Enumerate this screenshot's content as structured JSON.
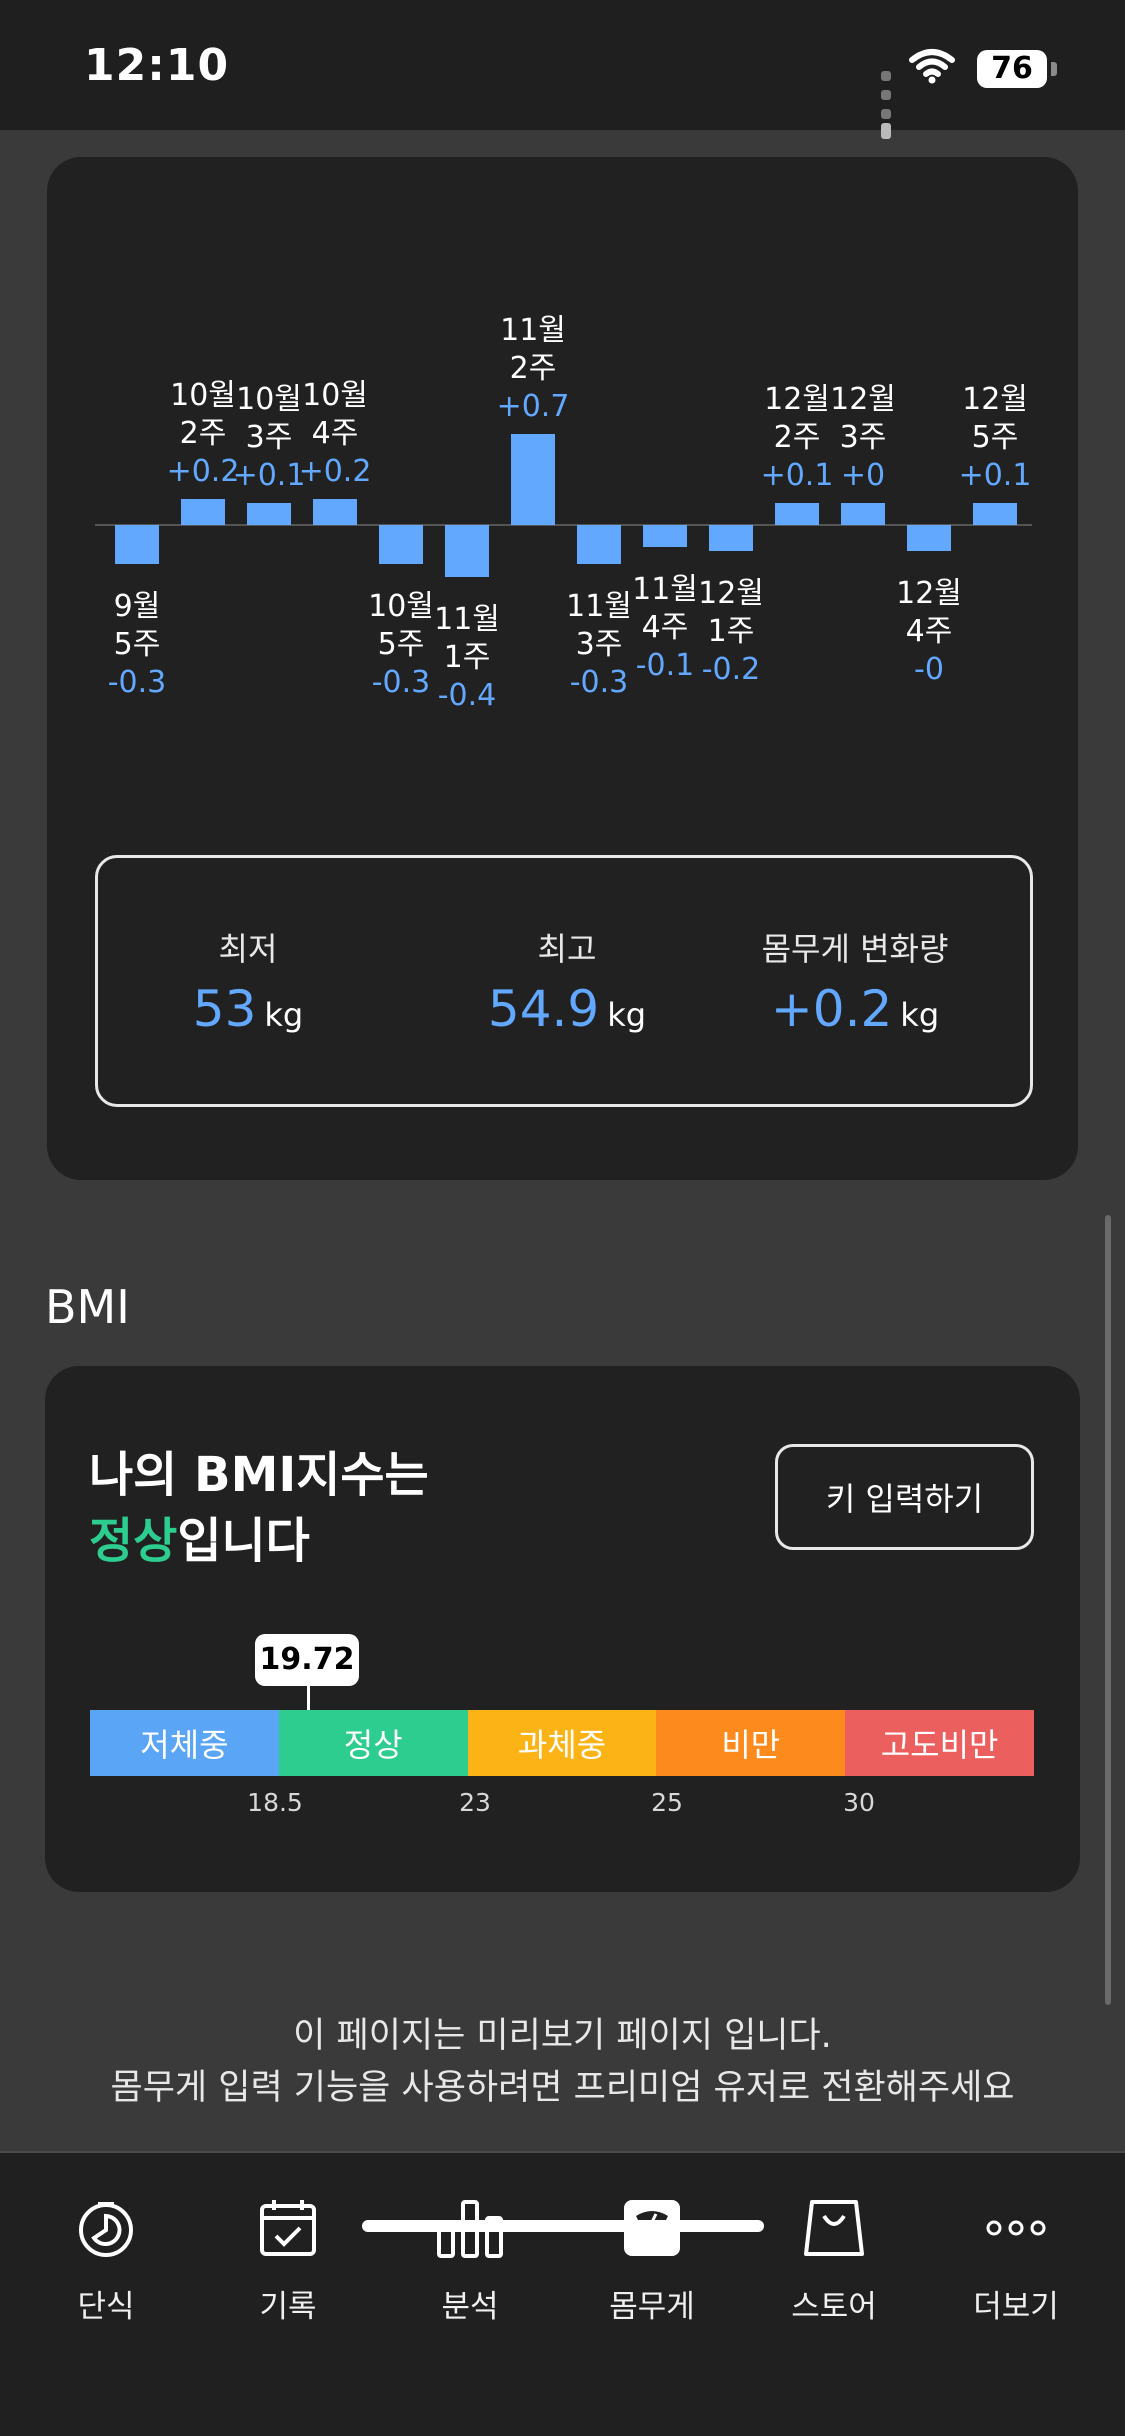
{
  "status_bar": {
    "time": "12:10",
    "battery": "76"
  },
  "chart_data": {
    "type": "bar",
    "categories": [
      "9월 5주",
      "10월 2주",
      "10월 3주",
      "10월 4주",
      "10월 5주",
      "11월 1주",
      "11월 2주",
      "11월 3주",
      "11월 4주",
      "12월 1주",
      "12월 2주",
      "12월 3주",
      "12월 4주",
      "12월 5주"
    ],
    "category_lines": [
      [
        "9월",
        "5주"
      ],
      [
        "10월",
        "2주"
      ],
      [
        "10월",
        "3주"
      ],
      [
        "10월",
        "4주"
      ],
      [
        "10월",
        "5주"
      ],
      [
        "11월",
        "1주"
      ],
      [
        "11월",
        "2주"
      ],
      [
        "11월",
        "3주"
      ],
      [
        "11월",
        "4주"
      ],
      [
        "12월",
        "1주"
      ],
      [
        "12월",
        "2주"
      ],
      [
        "12월",
        "3주"
      ],
      [
        "12월",
        "4주"
      ],
      [
        "12월",
        "5주"
      ]
    ],
    "values": [
      -0.3,
      0.2,
      0.1,
      0.2,
      -0.3,
      -0.4,
      0.7,
      -0.3,
      -0.1,
      -0.2,
      0.1,
      0.0,
      -0.0,
      0.1
    ],
    "value_labels": [
      "-0.3",
      "+0.2",
      "+0.1",
      "+0.2",
      "-0.3",
      "-0.4",
      "+0.7",
      "-0.3",
      "-0.1",
      "-0.2",
      "+0.1",
      "+0",
      "-0",
      "+0.1"
    ],
    "bar_color": "#63a8ff"
  },
  "stats": {
    "min": {
      "label": "최저",
      "value": "53",
      "unit": "kg"
    },
    "max": {
      "label": "최고",
      "value": "54.9",
      "unit": "kg"
    },
    "change": {
      "label": "몸무게 변화량",
      "value": "+0.2",
      "unit": "kg"
    }
  },
  "bmi": {
    "section_title": "BMI",
    "title_line1": "나의 BMI지수는",
    "status": "정상",
    "title_suffix": "입니다",
    "button_label": "키 입력하기",
    "value": "19.72",
    "segments": [
      {
        "label": "저체중",
        "color": "#5aa5f5"
      },
      {
        "label": "정상",
        "color": "#2dcc8f"
      },
      {
        "label": "과체중",
        "color": "#fcb316"
      },
      {
        "label": "비만",
        "color": "#fc8a1c"
      },
      {
        "label": "고도비만",
        "color": "#ec5f5f"
      }
    ],
    "ticks": [
      "18.5",
      "23",
      "25",
      "30"
    ]
  },
  "notice": {
    "line1": "이 페이지는 미리보기 페이지 입니다.",
    "line2": "몸무게 입력 기능을 사용하려면 프리미엄 유저로 전환해주세요"
  },
  "tabs": [
    {
      "label": "단식",
      "icon": "timer-icon"
    },
    {
      "label": "기록",
      "icon": "calendar-check-icon"
    },
    {
      "label": "분석",
      "icon": "bar-chart-icon"
    },
    {
      "label": "몸무게",
      "icon": "scale-icon"
    },
    {
      "label": "스토어",
      "icon": "shopping-bag-icon"
    },
    {
      "label": "더보기",
      "icon": "more-dots-icon"
    }
  ]
}
